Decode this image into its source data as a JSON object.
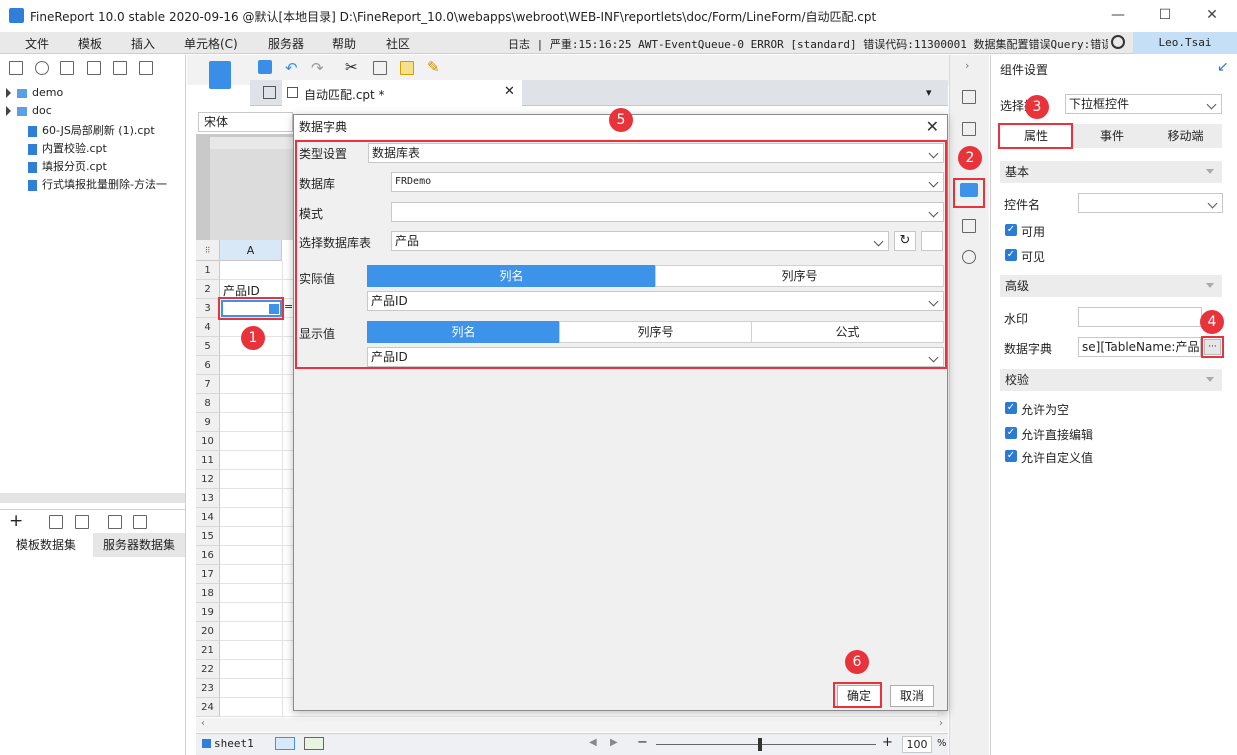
{
  "titlebar": {
    "title": "FineReport 10.0 stable 2020-09-16 @默认[本地目录]     D:\\FineReport_10.0\\webapps\\webroot\\WEB-INF\\reportlets\\doc/Form/LineForm/自动匹配.cpt",
    "minimize": "—",
    "maximize": "☐",
    "close": "✕"
  },
  "menubar": {
    "items": [
      "文件",
      "模板",
      "插入",
      "单元格(C)",
      "服务器",
      "帮助",
      "社区"
    ],
    "log_text": "日志 | 严重:15:16:25 AWT-EventQueue-0 ERROR [standard] 错误代码:11300001 数据集配置错误Query:错误...",
    "user": "Leo.Tsai"
  },
  "left_panel": {
    "tree": [
      {
        "label": "demo",
        "type": "folder"
      },
      {
        "label": "doc",
        "type": "folder"
      },
      {
        "label": "60-JS局部刷新 (1).cpt",
        "type": "file"
      },
      {
        "label": "内置校验.cpt",
        "type": "file"
      },
      {
        "label": "填报分页.cpt",
        "type": "file"
      },
      {
        "label": "行式填报批量删除-方法一",
        "type": "file"
      }
    ],
    "dataset_tabs": [
      "模板数据集",
      "服务器数据集"
    ]
  },
  "editor": {
    "tab_label": "自动匹配.cpt *",
    "font_name": "宋体",
    "column_header": "A",
    "cell_a2": "产品ID",
    "row_numbers": [
      "1",
      "2",
      "3",
      "4",
      "5",
      "6",
      "7",
      "8",
      "9",
      "10",
      "11",
      "12",
      "13",
      "14",
      "15",
      "16",
      "17",
      "18",
      "19",
      "20",
      "21",
      "22",
      "23",
      "24"
    ],
    "sheet_tab": "sheet1",
    "zoom": "100",
    "zoom_unit": "%",
    "zoom_minus": "−",
    "zoom_plus": "+"
  },
  "dialog": {
    "title": "数据字典",
    "close": "✕",
    "type_label": "类型设置",
    "type_value": "数据库表",
    "db_label": "数据库",
    "db_value": "FRDemo",
    "schema_label": "模式",
    "schema_value": "",
    "table_label": "选择数据库表",
    "table_value": "产品",
    "actual_label": "实际值",
    "actual_tabs": [
      "列名",
      "列序号"
    ],
    "actual_value": "产品ID",
    "display_label": "显示值",
    "display_tabs": [
      "列名",
      "列序号",
      "公式"
    ],
    "display_value": "产品ID",
    "ok": "确定",
    "cancel": "取消"
  },
  "right_panel": {
    "title": "组件设置",
    "select_label": "选择控件",
    "select_value": "下拉框控件",
    "tabs": [
      "属性",
      "事件",
      "移动端"
    ],
    "section_basic": "基本",
    "widget_name_label": "控件名",
    "widget_name_value": "",
    "enabled_label": "可用",
    "visible_label": "可见",
    "section_advanced": "高级",
    "watermark_label": "水印",
    "watermark_value": "",
    "dict_label": "数据字典",
    "dict_value": "se][TableName:产品]",
    "dict_btn": "···",
    "section_validate": "校验",
    "allow_empty": "允许为空",
    "allow_direct_edit": "允许直接编辑",
    "allow_custom": "允许自定义值"
  },
  "annotations": [
    "1",
    "2",
    "3",
    "4",
    "5",
    "6"
  ],
  "colors": {
    "accent": "#3d92e9",
    "annotation": "#e8333b",
    "user_bg": "#c5dff6"
  }
}
